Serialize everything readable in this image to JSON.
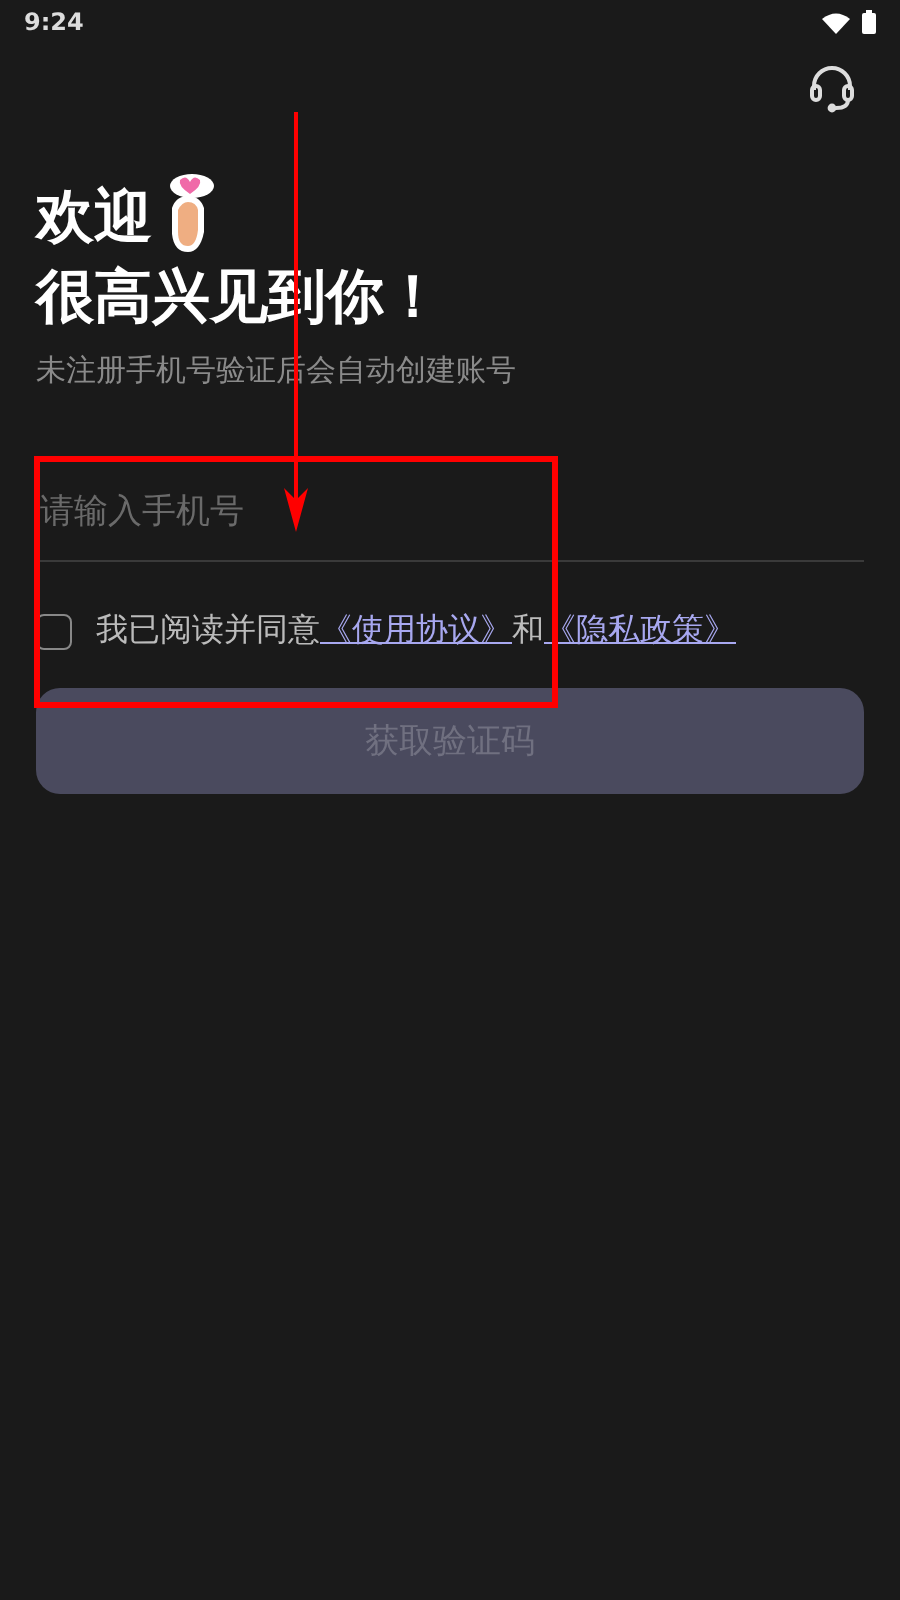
{
  "status_bar": {
    "time": "9:24"
  },
  "greeting": {
    "line_1": "欢迎",
    "line_2": "很高兴见到你！",
    "subtitle": "未注册手机号验证后会自动创建账号"
  },
  "phone_field": {
    "placeholder": "请输入手机号"
  },
  "agreement": {
    "checked": false,
    "parts": [
      {
        "kind": "text",
        "text": "我已阅读并同意"
      },
      {
        "kind": "link",
        "text": "《使用协议》"
      },
      {
        "kind": "text",
        "text": "和"
      },
      {
        "kind": "link",
        "text": "《隐私政策》"
      }
    ]
  },
  "submit_button": {
    "label": "获取验证码",
    "disabled": true
  }
}
